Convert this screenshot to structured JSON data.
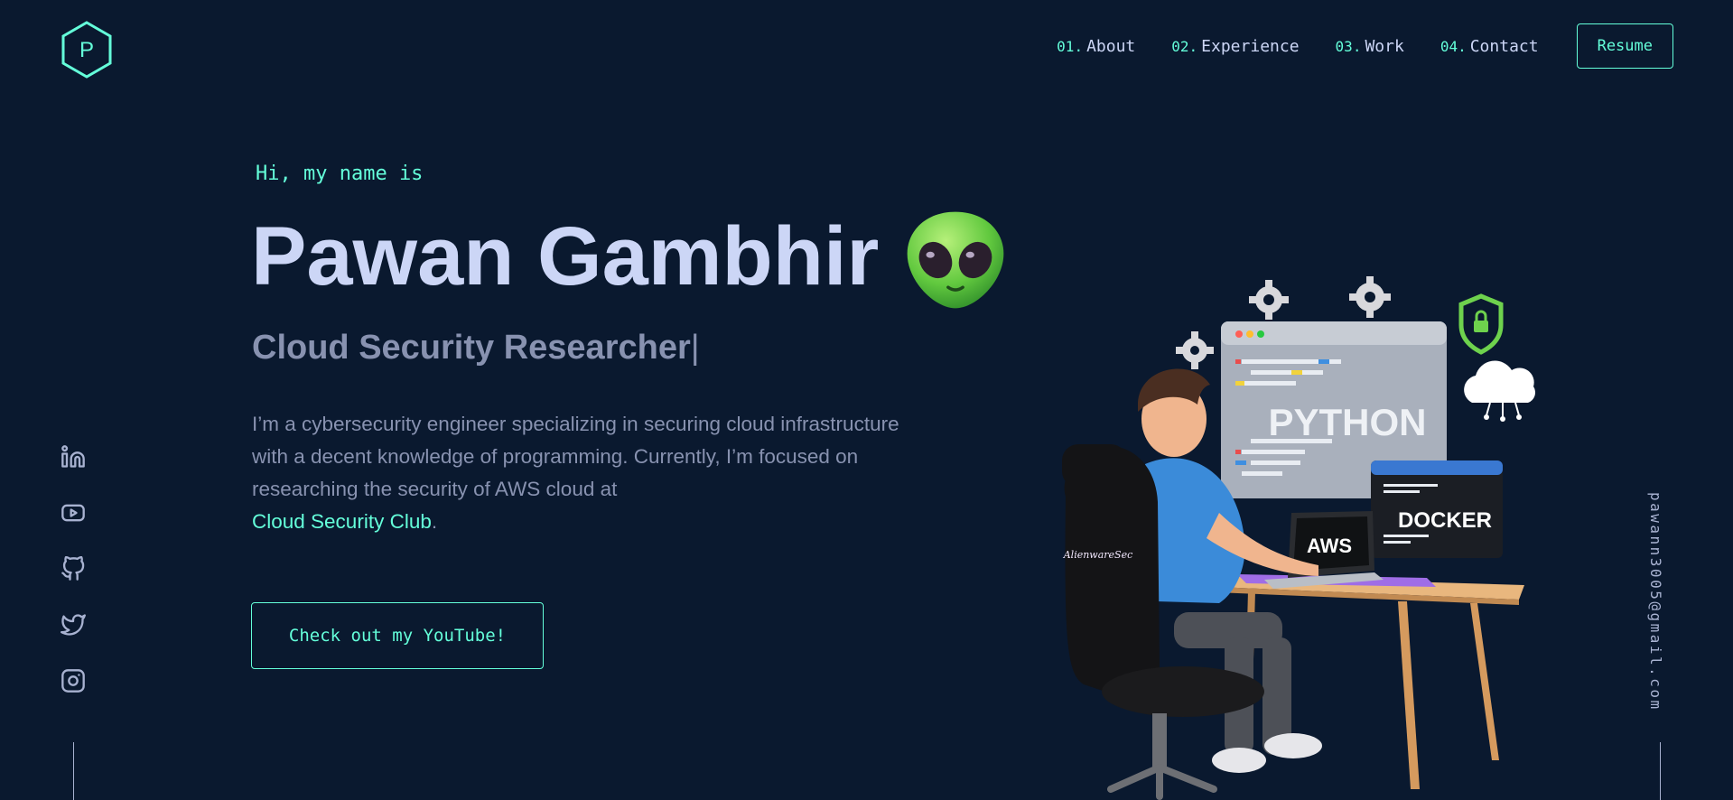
{
  "brand": {
    "logo_letter": "P"
  },
  "nav": {
    "items": [
      {
        "num": "01.",
        "label": "About"
      },
      {
        "num": "02.",
        "label": "Experience"
      },
      {
        "num": "03.",
        "label": "Work"
      },
      {
        "num": "04.",
        "label": "Contact"
      }
    ],
    "resume_label": "Resume"
  },
  "hero": {
    "greeting": "Hi, my name is",
    "name": "Pawan Gambhir",
    "subtitle": "Cloud Security Researcher",
    "cursor": "|",
    "bio": "I’m a cybersecurity engineer specializing in securing cloud infrastructure with a decent knowledge of programming. Currently, I’m focused on researching the security of AWS cloud at",
    "bio_link": "Cloud Security Club",
    "bio_end": ".",
    "cta_label": "Check out my YouTube!"
  },
  "social": [
    "linkedin-icon",
    "youtube-icon",
    "github-icon",
    "twitter-icon",
    "instagram-icon"
  ],
  "email": "pawann3005@gmail.com",
  "illustration": {
    "screen_text": "PYTHON",
    "laptop_text": "AWS",
    "terminal_text": "DOCKER",
    "chair_text": "AlienwareSec"
  },
  "colors": {
    "background": "#0a192f",
    "accent": "#64ffda",
    "heading": "#ccd6f6",
    "body": "#8892b0"
  }
}
